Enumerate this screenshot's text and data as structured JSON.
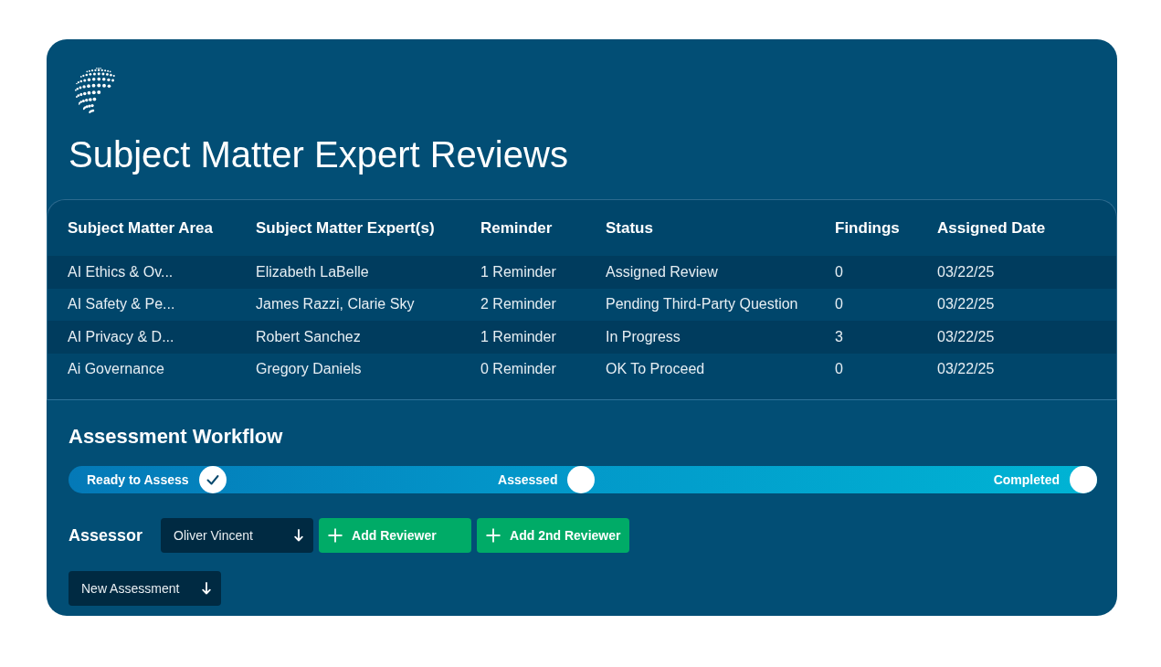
{
  "page": {
    "title": "Subject Matter Expert Reviews"
  },
  "table": {
    "columns": [
      "Subject Matter Area",
      "Subject Matter Expert(s)",
      "Reminder",
      "Status",
      "Findings",
      "Assigned Date"
    ],
    "rows": [
      {
        "cells": [
          "AI Ethics & Ov...",
          "Elizabeth LaBelle",
          "1 Reminder",
          "Assigned Review",
          "0",
          "03/22/25"
        ]
      },
      {
        "cells": [
          "AI Safety & Pe...",
          "James Razzi, Clarie Sky",
          "2 Reminder",
          "Pending Third-Party Question",
          "0",
          "03/22/25"
        ]
      },
      {
        "cells": [
          "AI Privacy & D...",
          "Robert Sanchez",
          "1 Reminder",
          "In Progress",
          "3",
          "03/22/25"
        ]
      },
      {
        "cells": [
          "Ai Governance",
          "Gregory Daniels",
          "0 Reminder",
          "OK To Proceed",
          "0",
          "03/22/25"
        ]
      }
    ]
  },
  "workflow": {
    "title": "Assessment Workflow",
    "steps": [
      {
        "label": "Ready to Assess",
        "done": true
      },
      {
        "label": "Assessed",
        "done": false
      },
      {
        "label": "Completed",
        "done": false
      }
    ]
  },
  "assessor": {
    "label": "Assessor",
    "dropdown": {
      "value": "Oliver Vincent"
    },
    "buttons": [
      {
        "label": "Add Reviewer"
      },
      {
        "label": "Add 2nd Reviewer"
      }
    ]
  },
  "new_assessment": {
    "label": "New Assessment"
  }
}
